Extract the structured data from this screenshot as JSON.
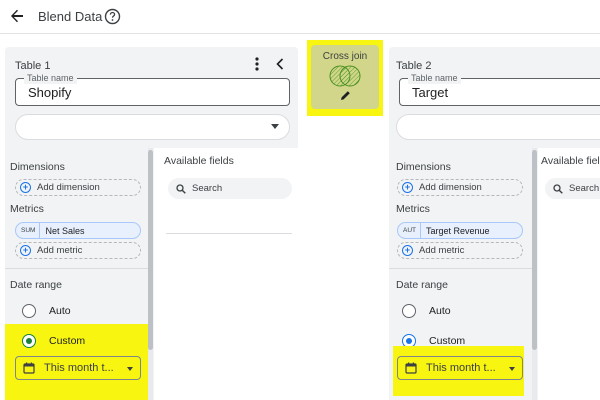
{
  "header": {
    "title": "Blend Data"
  },
  "join": {
    "label": "Cross join"
  },
  "tables": [
    {
      "title": "Table 1",
      "name_legend": "Table name",
      "name_value": "Shopify",
      "data_source": "",
      "dimensions_label": "Dimensions",
      "add_dimension": "Add dimension",
      "metrics_label": "Metrics",
      "metric_chip": {
        "aggregation": "SUM",
        "field": "Net Sales"
      },
      "add_metric": "Add metric",
      "date_range_label": "Date range",
      "radio_auto": "Auto",
      "radio_custom": "Custom",
      "date_value": "This month t...",
      "fields_label": "Available fields",
      "search_placeholder": "Search"
    },
    {
      "title": "Table 2",
      "name_legend": "Table name",
      "name_value": "Target",
      "data_source": "",
      "dimensions_label": "Dimensions",
      "add_dimension": "Add dimension",
      "metrics_label": "Metrics",
      "metric_chip": {
        "aggregation": "AUT",
        "field": "Target Revenue"
      },
      "add_metric": "Add metric",
      "date_range_label": "Date range",
      "radio_auto": "Auto",
      "radio_custom": "Custom",
      "date_value": "This month t...",
      "fields_label": "Available fiel",
      "search_placeholder": "Search"
    }
  ],
  "colors": {
    "highlight": "#f8f511",
    "accent_blue": "#1a73e8",
    "selected_green": "#188038",
    "panel_bg": "#f1f3f4"
  }
}
